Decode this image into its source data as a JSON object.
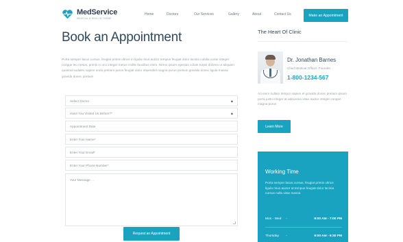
{
  "header": {
    "brand_name": "MedService",
    "brand_tagline": "MEDICAL & HEALTH THEME",
    "nav": [
      {
        "label": "Home"
      },
      {
        "label": "Doctors"
      },
      {
        "label": "Our Services"
      },
      {
        "label": "Gallery"
      },
      {
        "label": "About"
      },
      {
        "label": "Contact Us"
      }
    ],
    "cta_label": "Make an Appointment",
    "logo_icon": "heart-pulse-icon"
  },
  "main": {
    "title": "Book an Appointment",
    "intro": "Porta semper lacus cursus, feugiat primis ultrice in ligula risus auctor tempus feugiat dolor lacinia cubilia curae integer congue leo metus, primis in orci integer metus mollis faucibus enim. Nemo ipsam egestas volute turpis dolores ut aliquam quaerat sodales sapien undo pretium purus feugiat dolor impendiet magna purus pretium gravida donec ligula massa gravida donec pretium",
    "form": {
      "select_doctor": "Select Doctor",
      "visited_before": "Have You Visited Us Before?*",
      "date_placeholder": "Appointment Date",
      "name_placeholder": "Enter Your Name*",
      "email_placeholder": "Enter Your Email*",
      "phone_placeholder": "Enter Your Phone Number*",
      "message_placeholder": "Your Message ...",
      "submit_label": "Request an Appointment"
    }
  },
  "sidebar": {
    "heading": "The Heart Of Clinic",
    "doctor": {
      "name": "Dr. Jonathan Barnes",
      "role": "Chief Medical Officer, Founder",
      "phone": "1-800-1234-567"
    },
    "text": "An enim nullam tempor sapien et gravida donec pretium ipsum porta justo integer at adiscenia vitae auctor integer congue magna purus",
    "learn_more_label": "Learn More",
    "working_time": {
      "title": "Working Time",
      "text": "Porta semper lacus cursus, feugiat primis ultrice ligula risus auctor at tempus feugiat dolor lacinia cursus nulla vitae massa",
      "rows": [
        {
          "day": "Mon - Wed",
          "sep": "-",
          "hours": "9:00 AM - 7:00 PM"
        },
        {
          "day": "Thursday",
          "sep": "-",
          "hours": "9:00 AM - 6:30 PM"
        }
      ]
    }
  },
  "colors": {
    "accent": "#1aa3c1",
    "heading": "#30495b",
    "muted_text": "#9aa3a8"
  }
}
